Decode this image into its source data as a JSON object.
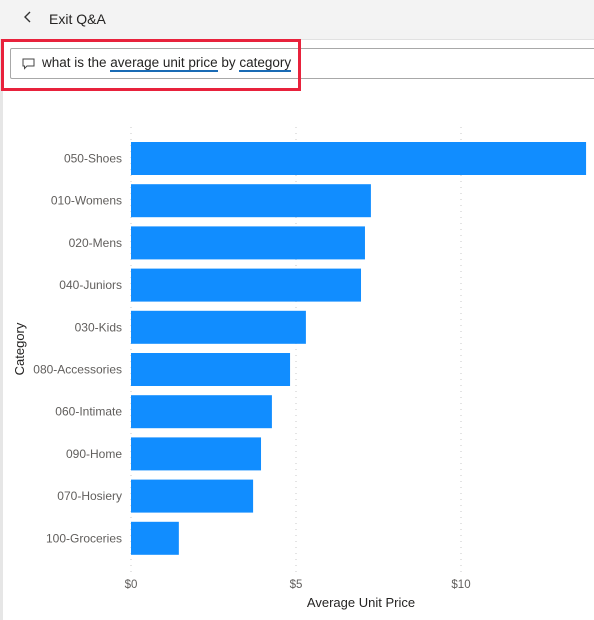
{
  "header": {
    "back_icon": "chevron-left-icon",
    "exit_label": "Exit Q&A"
  },
  "qa": {
    "icon": "speech-bubble-icon",
    "query_parts": [
      {
        "text": "what is the ",
        "term": false
      },
      {
        "text": "average unit price",
        "term": true
      },
      {
        "text": " by ",
        "term": false
      },
      {
        "text": "category",
        "term": true
      }
    ],
    "highlight_color": "#e8223c"
  },
  "chart_data": {
    "type": "bar",
    "orientation": "horizontal",
    "title": "",
    "xlabel": "Average Unit Price",
    "ylabel": "Category",
    "categories": [
      "050-Shoes",
      "010-Womens",
      "020-Mens",
      "040-Juniors",
      "030-Kids",
      "080-Accessories",
      "060-Intimate",
      "090-Home",
      "070-Hosiery",
      "100-Groceries"
    ],
    "values": [
      13.79,
      7.27,
      7.09,
      6.97,
      5.3,
      4.82,
      4.27,
      3.94,
      3.7,
      1.45
    ],
    "xlim": [
      0,
      14
    ],
    "xticks": [
      0,
      5,
      10
    ],
    "xtick_labels": [
      "$0",
      "$5",
      "$10"
    ],
    "grid": true,
    "bar_color": "#118dff"
  }
}
